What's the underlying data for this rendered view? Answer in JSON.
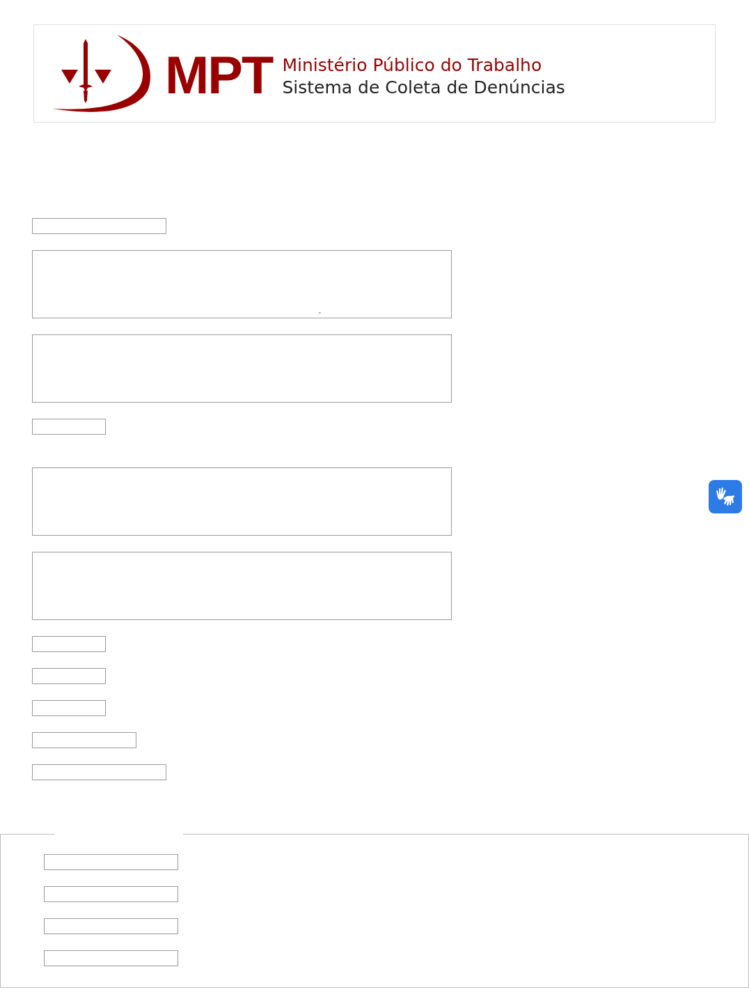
{
  "header": {
    "acronym": "MPT",
    "title": "Ministério Público do Trabalho",
    "subtitle": "Sistema de Coleta de Denúncias"
  },
  "fields": [
    {
      "kind": "long"
    },
    {
      "kind": "textarea",
      "stray_mark": "˜"
    },
    {
      "kind": "textarea"
    },
    {
      "kind": "short"
    },
    {
      "kind": "textarea"
    },
    {
      "kind": "textarea"
    },
    {
      "kind": "short"
    },
    {
      "kind": "short"
    },
    {
      "kind": "short"
    },
    {
      "kind": "medium"
    },
    {
      "kind": "long"
    }
  ],
  "fieldset": {
    "fields": [
      {
        "kind": "long"
      },
      {
        "kind": "long"
      },
      {
        "kind": "long"
      },
      {
        "kind": "long"
      }
    ]
  }
}
